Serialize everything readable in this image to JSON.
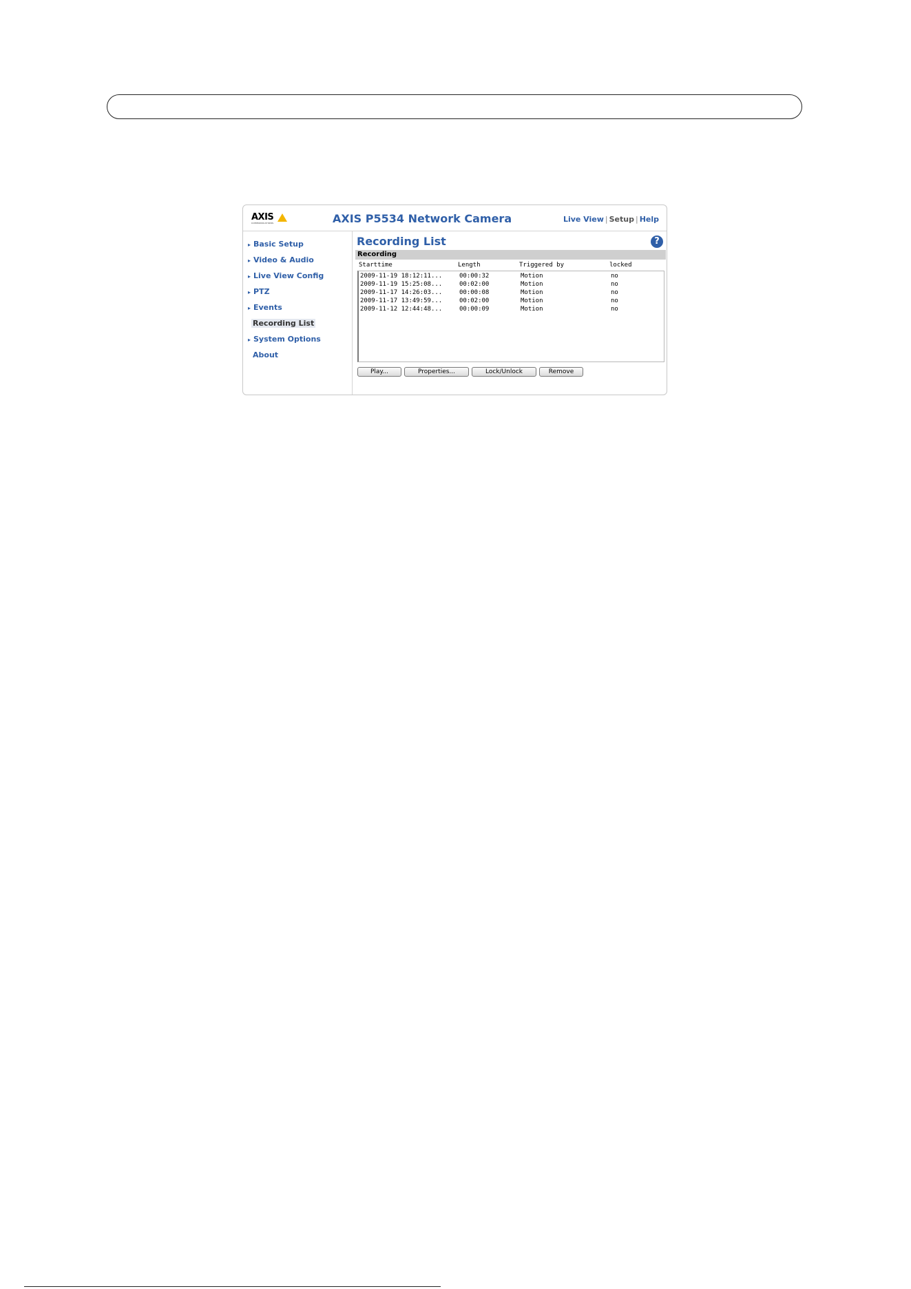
{
  "window": {
    "logo": {
      "name": "AXIS",
      "subtext": "COMMUNICATIONS"
    },
    "title": "AXIS P5534 Network Camera",
    "topnav": {
      "live_view": "Live View",
      "setup": "Setup",
      "help": "Help",
      "separator": "|"
    }
  },
  "sidebar": {
    "items": [
      {
        "label": "Basic Setup",
        "arrow": true
      },
      {
        "label": "Video & Audio",
        "arrow": true
      },
      {
        "label": "Live View Config",
        "arrow": true
      },
      {
        "label": "PTZ",
        "arrow": true
      },
      {
        "label": "Events",
        "arrow": true
      },
      {
        "label": "Recording List",
        "arrow": false,
        "active": true
      },
      {
        "label": "System Options",
        "arrow": true
      },
      {
        "label": "About",
        "arrow": false
      }
    ]
  },
  "main": {
    "page_title": "Recording List",
    "help_icon": "?",
    "section_title": "Recording",
    "table": {
      "columns": [
        "Starttime",
        "Length",
        "Triggered by",
        "locked"
      ],
      "rows": [
        [
          "2009-11-19 18:12:11...",
          "00:00:32",
          "Motion",
          "no"
        ],
        [
          "2009-11-19 15:25:08...",
          "00:02:00",
          "Motion",
          "no"
        ],
        [
          "2009-11-17 14:26:03...",
          "00:00:08",
          "Motion",
          "no"
        ],
        [
          "2009-11-17 13:49:59...",
          "00:02:00",
          "Motion",
          "no"
        ],
        [
          "2009-11-12 12:44:48...",
          "00:00:09",
          "Motion",
          "no"
        ]
      ]
    },
    "buttons": {
      "play": "Play...",
      "properties": "Properties...",
      "lock_unlock": "Lock/Unlock",
      "remove": "Remove"
    }
  },
  "colors": {
    "accent": "#2f5fa8",
    "section_bar": "#cfcfcf",
    "logo_triangle": "#f3b500"
  },
  "icons": {
    "nav_arrow": "triangle-right-icon",
    "help": "question-circle-icon",
    "logo": "axis-logo-icon"
  }
}
